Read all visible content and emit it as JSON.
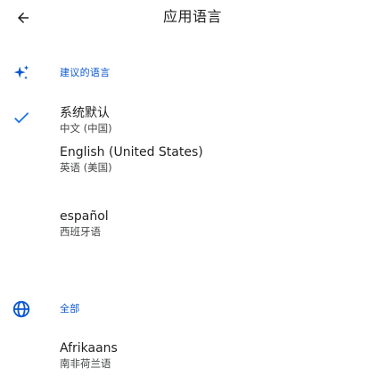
{
  "header": {
    "title": "应用语言",
    "back_icon": "arrow-back-icon"
  },
  "suggested": {
    "icon": "sparkle-icon",
    "label": "建议的语言",
    "items": [
      {
        "name": "系统默认",
        "subtitle": "中文 (中国)",
        "selected": true
      },
      {
        "name": "English (United States)",
        "subtitle": "英语 (美国)",
        "selected": false
      },
      {
        "name": "español",
        "subtitle": "西班牙语",
        "selected": false
      }
    ]
  },
  "all": {
    "icon": "globe-icon",
    "label": "全部",
    "items": [
      {
        "name": "Afrikaans",
        "subtitle": "南非荷兰语",
        "selected": false
      }
    ]
  },
  "colors": {
    "accent": "#0b57d0",
    "text_primary": "#1f1f1f",
    "text_secondary": "#444746",
    "icon": "#1a73e8"
  }
}
